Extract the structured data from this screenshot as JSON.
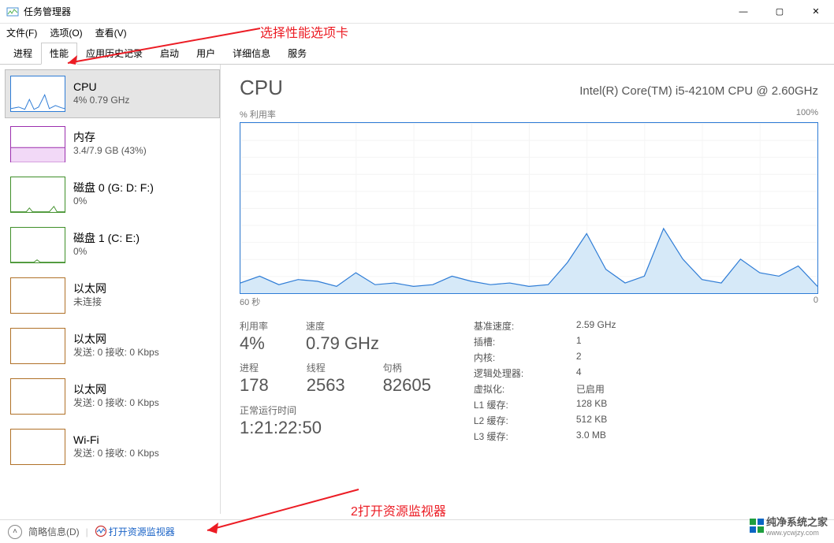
{
  "window": {
    "title": "任务管理器"
  },
  "menu": {
    "file": "文件(F)",
    "options": "选项(O)",
    "view": "查看(V)"
  },
  "tabs": {
    "processes": "进程",
    "performance": "性能",
    "appHistory": "应用历史记录",
    "startup": "启动",
    "users": "用户",
    "details": "详细信息",
    "services": "服务"
  },
  "sidebar": [
    {
      "name": "CPU",
      "sub": "4% 0.79 GHz",
      "color": "#2e7cd6"
    },
    {
      "name": "内存",
      "sub": "3.4/7.9 GB (43%)",
      "color": "#9b2fae"
    },
    {
      "name": "磁盘 0 (G: D: F:)",
      "sub": "0%",
      "color": "#3f8f29"
    },
    {
      "name": "磁盘 1 (C: E:)",
      "sub": "0%",
      "color": "#3f8f29"
    },
    {
      "name": "以太网",
      "sub": "未连接",
      "color": "#b07128"
    },
    {
      "name": "以太网",
      "sub": "发送: 0 接收: 0 Kbps",
      "color": "#b07128"
    },
    {
      "name": "以太网",
      "sub": "发送: 0 接收: 0 Kbps",
      "color": "#b07128"
    },
    {
      "name": "Wi-Fi",
      "sub": "发送: 0 接收: 0 Kbps",
      "color": "#b07128"
    }
  ],
  "main": {
    "title": "CPU",
    "model": "Intel(R) Core(TM) i5-4210M CPU @ 2.60GHz",
    "axisLabel": "% 利用率",
    "axisMax": "100%",
    "axisXLeft": "60 秒",
    "axisXRight": "0",
    "stats": {
      "util_l": "利用率",
      "util_v": "4%",
      "speed_l": "速度",
      "speed_v": "0.79 GHz",
      "proc_l": "进程",
      "proc_v": "178",
      "thread_l": "线程",
      "thread_v": "2563",
      "handle_l": "句柄",
      "handle_v": "82605",
      "uptime_l": "正常运行时间",
      "uptime_v": "1:21:22:50"
    },
    "props": {
      "baseSpeed_l": "基准速度:",
      "baseSpeed_v": "2.59 GHz",
      "sockets_l": "插槽:",
      "sockets_v": "1",
      "cores_l": "内核:",
      "cores_v": "2",
      "logical_l": "逻辑处理器:",
      "logical_v": "4",
      "virt_l": "虚拟化:",
      "virt_v": "已启用",
      "l1_l": "L1 缓存:",
      "l1_v": "128 KB",
      "l2_l": "L2 缓存:",
      "l2_v": "512 KB",
      "l3_l": "L3 缓存:",
      "l3_v": "3.0 MB"
    }
  },
  "footer": {
    "brief": "简略信息(D)",
    "resmon": "打开资源监视器"
  },
  "annotations": {
    "a1": "选择性能选项卡",
    "a2": "2打开资源监视器"
  },
  "watermark": {
    "text": "纯净系统之家",
    "url": "www.ycwjzy.com"
  },
  "chart_data": {
    "type": "line",
    "title": "% 利用率",
    "xlabel": "60 秒",
    "ylabel": "% 利用率",
    "ylim": [
      0,
      100
    ],
    "x_seconds_ago": [
      60,
      58,
      56,
      54,
      52,
      50,
      48,
      46,
      44,
      42,
      40,
      38,
      36,
      34,
      32,
      30,
      28,
      26,
      24,
      22,
      20,
      18,
      16,
      14,
      12,
      10,
      8,
      6,
      4,
      2,
      0
    ],
    "values": [
      6,
      10,
      5,
      8,
      7,
      4,
      12,
      5,
      6,
      4,
      5,
      10,
      7,
      5,
      6,
      4,
      5,
      18,
      35,
      14,
      6,
      10,
      38,
      20,
      8,
      6,
      20,
      12,
      10,
      16,
      4
    ]
  }
}
